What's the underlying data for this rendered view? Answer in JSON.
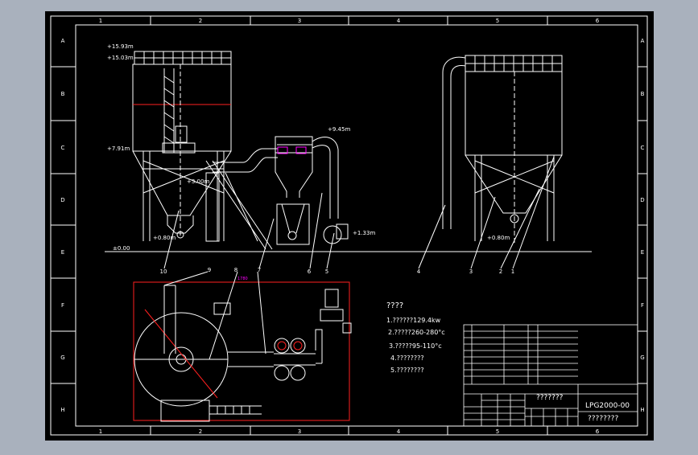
{
  "colors": {
    "background": "#a9b1bd",
    "canvas": "#000000",
    "line": "#ffffff",
    "accent_red": "#ff2020",
    "accent_magenta": "#ff00ff"
  },
  "frame": {
    "columns": [
      "1",
      "2",
      "3",
      "4",
      "5",
      "6"
    ],
    "rows": [
      "A",
      "B",
      "C",
      "D",
      "E",
      "F",
      "G",
      "H"
    ]
  },
  "elevations": {
    "top_1": "+15.93m",
    "top_2": "+15.03m",
    "mid": "+7.91m",
    "cyclone_top": "+9.45m",
    "fan": "+1.33m",
    "ground": "±0.00",
    "discharge_left": "+0.80m",
    "discharge_right": "+0.80m",
    "plan_ring": "+3.00m"
  },
  "callouts": [
    "1",
    "2",
    "3",
    "4",
    "5",
    "6",
    "7",
    "8",
    "9",
    "10"
  ],
  "notes": {
    "title": "????",
    "items": [
      "1.??????129.4kw",
      "2.?????260-280°c",
      "3.?????95-110°c",
      "4.????????",
      "5.????????"
    ]
  },
  "title_block": {
    "drawing_name": "???????",
    "drawing_no": "LPG2000-00",
    "company": "????????"
  }
}
